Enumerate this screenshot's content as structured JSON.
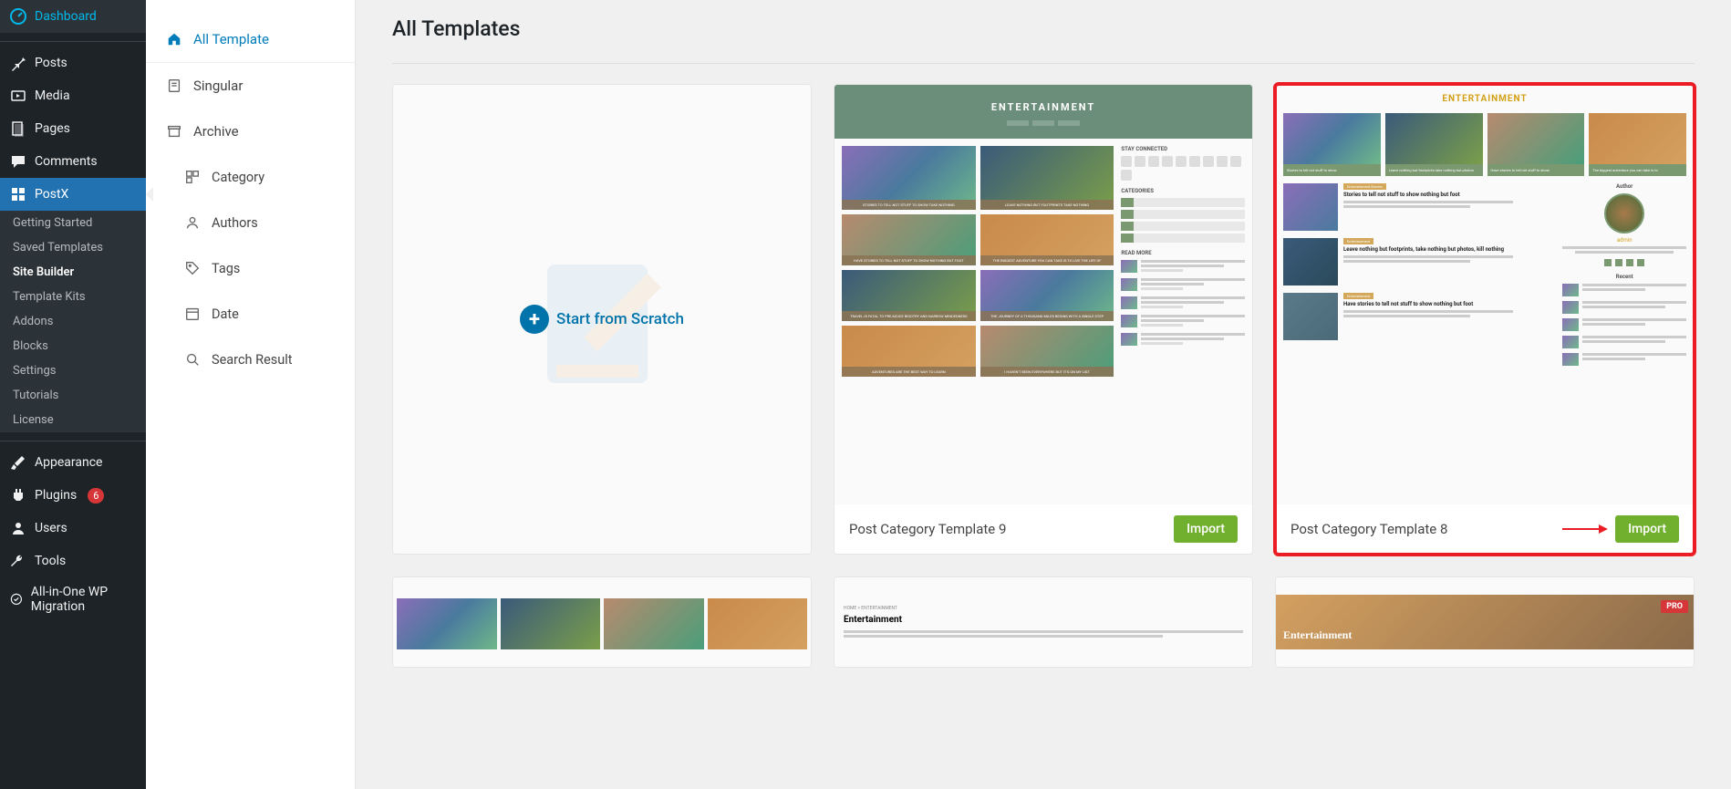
{
  "wp_menu": {
    "dashboard": "Dashboard",
    "posts": "Posts",
    "media": "Media",
    "pages": "Pages",
    "comments": "Comments",
    "postx": "PostX",
    "appearance": "Appearance",
    "plugins": "Plugins",
    "plugins_badge": "6",
    "users": "Users",
    "tools": "Tools",
    "aio": "All-in-One WP Migration"
  },
  "postx_submenu": {
    "getting_started": "Getting Started",
    "saved_templates": "Saved Templates",
    "site_builder": "Site Builder",
    "template_kits": "Template Kits",
    "addons": "Addons",
    "blocks": "Blocks",
    "settings": "Settings",
    "tutorials": "Tutorials",
    "license": "License"
  },
  "sub_sidebar": {
    "all_template": "All Template",
    "singular": "Singular",
    "archive": "Archive",
    "category": "Category",
    "authors": "Authors",
    "tags": "Tags",
    "date": "Date",
    "search_result": "Search Result"
  },
  "main": {
    "heading": "All Templates",
    "scratch_label": "Start from Scratch",
    "import_label": "Import",
    "pro_label": "PRO",
    "cards": {
      "tpl9": "Post Category Template 9",
      "tpl8": "Post Category Template 8",
      "entertainment_heading": "ENTERTAINMENT",
      "entertainment_word": "Entertainment",
      "stay_connected": "STAY CONNECTED",
      "categories": "CATEGORIES",
      "read_more": "READ MORE",
      "author": "Author",
      "recent": "Recent",
      "breadcrumb": "HOME > ENTERTAINMENT"
    }
  }
}
